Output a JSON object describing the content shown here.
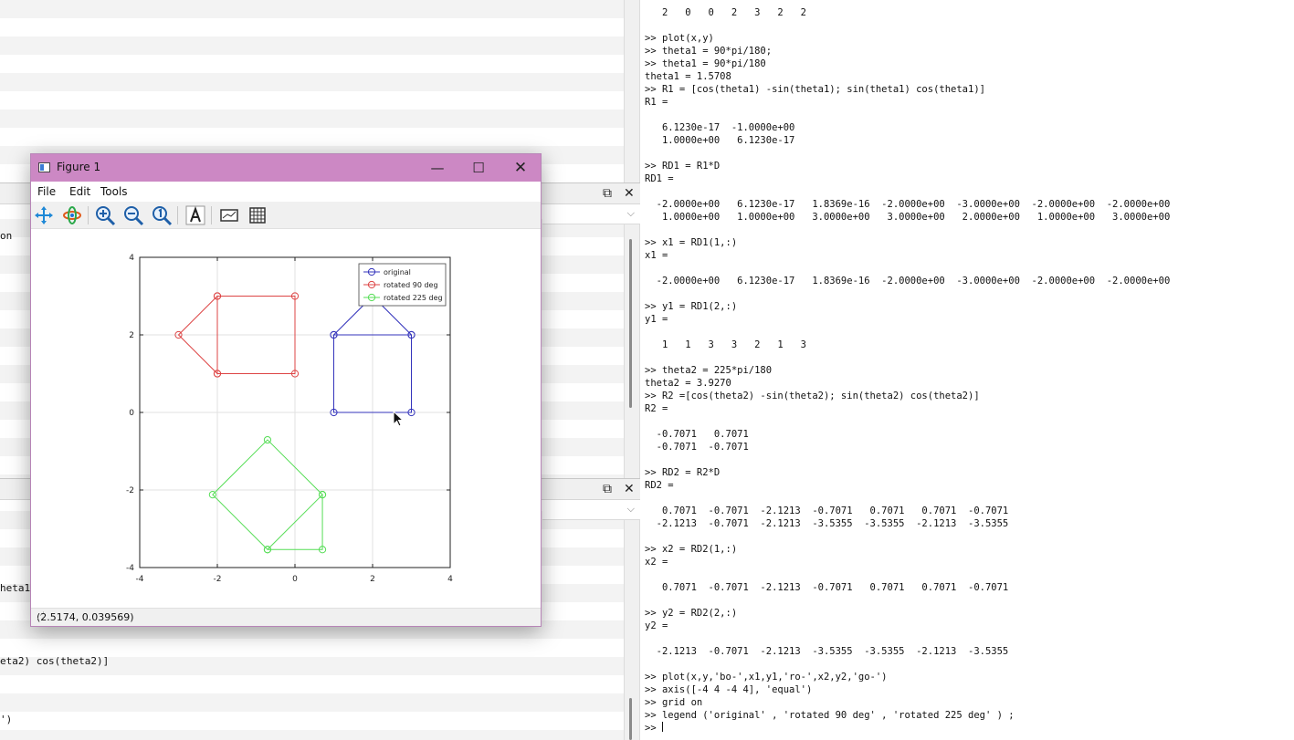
{
  "background": {
    "left_snippets": [
      "on",
      "heta1",
      "eta2) cos(theta2)]",
      "')"
    ]
  },
  "console": {
    "lines": [
      "   2   0   0   2   3   2   2",
      "",
      ">> plot(x,y)",
      ">> theta1 = 90*pi/180;",
      ">> theta1 = 90*pi/180",
      "theta1 = 1.5708",
      ">> R1 = [cos(theta1) -sin(theta1); sin(theta1) cos(theta1)]",
      "R1 =",
      "",
      "   6.1230e-17  -1.0000e+00",
      "   1.0000e+00   6.1230e-17",
      "",
      ">> RD1 = R1*D",
      "RD1 =",
      "",
      "  -2.0000e+00   6.1230e-17   1.8369e-16  -2.0000e+00  -3.0000e+00  -2.0000e+00  -2.0000e+00",
      "   1.0000e+00   1.0000e+00   3.0000e+00   3.0000e+00   2.0000e+00   1.0000e+00   3.0000e+00",
      "",
      ">> x1 = RD1(1,:)",
      "x1 =",
      "",
      "  -2.0000e+00   6.1230e-17   1.8369e-16  -2.0000e+00  -3.0000e+00  -2.0000e+00  -2.0000e+00",
      "",
      ">> y1 = RD1(2,:)",
      "y1 =",
      "",
      "   1   1   3   3   2   1   3",
      "",
      ">> theta2 = 225*pi/180",
      "theta2 = 3.9270",
      ">> R2 =[cos(theta2) -sin(theta2); sin(theta2) cos(theta2)]",
      "R2 =",
      "",
      "  -0.7071   0.7071",
      "  -0.7071  -0.7071",
      "",
      ">> RD2 = R2*D",
      "RD2 =",
      "",
      "   0.7071  -0.7071  -2.1213  -0.7071   0.7071   0.7071  -0.7071",
      "  -2.1213  -0.7071  -2.1213  -3.5355  -3.5355  -2.1213  -3.5355",
      "",
      ">> x2 = RD2(1,:)",
      "x2 =",
      "",
      "   0.7071  -0.7071  -2.1213  -0.7071   0.7071   0.7071  -0.7071",
      "",
      ">> y2 = RD2(2,:)",
      "y2 =",
      "",
      "  -2.1213  -0.7071  -2.1213  -3.5355  -3.5355  -2.1213  -3.5355",
      "",
      ">> plot(x,y,'bo-',x1,y1,'ro-',x2,y2,'go-')",
      ">> axis([-4 4 -4 4], 'equal')",
      ">> grid on",
      ">> legend ('original' , 'rotated 90 deg' , 'rotated 225 deg' ) ;"
    ],
    "prompt": ">> "
  },
  "figure": {
    "title": "Figure 1",
    "menu": {
      "file": "File",
      "edit": "Edit",
      "tools": "Tools"
    },
    "status": "(2.5174, 0.039569)",
    "colors": {
      "title_bar": "#cc88c4",
      "original": "#3333bb",
      "rot90": "#dd4444",
      "rot225": "#55dd55"
    }
  },
  "chart_data": {
    "type": "line",
    "xlim": [
      -4,
      4
    ],
    "ylim": [
      -4,
      4
    ],
    "xticks": [
      -4,
      -2,
      0,
      2,
      4
    ],
    "yticks": [
      -4,
      -2,
      0,
      2,
      4
    ],
    "grid": true,
    "legend_position": "top-right",
    "series": [
      {
        "name": "original",
        "color": "#3333bb",
        "x": [
          1,
          1,
          3,
          3,
          2,
          1,
          3
        ],
        "y": [
          2,
          0,
          0,
          2,
          3,
          2,
          2
        ]
      },
      {
        "name": "rotated 90 deg",
        "color": "#dd4444",
        "x": [
          -2,
          0,
          0,
          -2,
          -3,
          -2,
          -2
        ],
        "y": [
          1,
          1,
          3,
          3,
          2,
          1,
          3
        ]
      },
      {
        "name": "rotated 225 deg",
        "color": "#55dd55",
        "x": [
          0.7071,
          -0.7071,
          -2.1213,
          -0.7071,
          0.7071,
          0.7071,
          -0.7071
        ],
        "y": [
          -2.1213,
          -0.7071,
          -2.1213,
          -3.5355,
          -3.5355,
          -2.1213,
          -3.5355
        ]
      }
    ]
  }
}
